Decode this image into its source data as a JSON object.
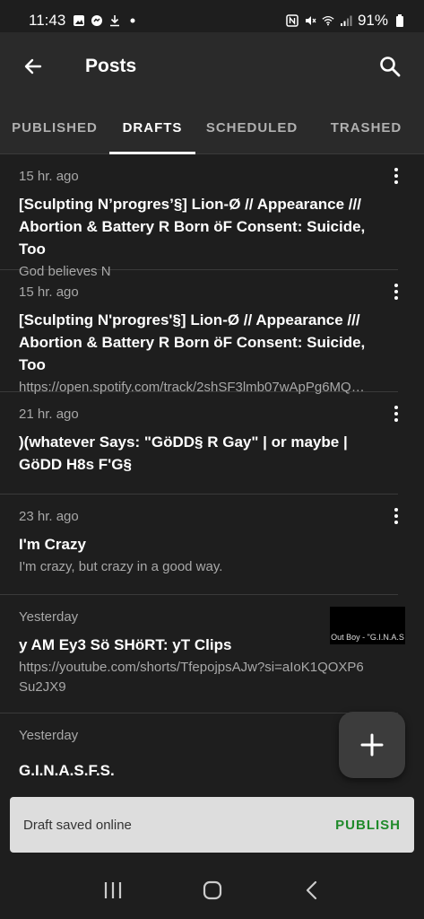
{
  "status_bar": {
    "time": "11:43",
    "battery": "91%"
  },
  "app_bar": {
    "title": "Posts"
  },
  "tabs": [
    {
      "label": "PUBLISHED",
      "active": false
    },
    {
      "label": "DRAFTS",
      "active": true
    },
    {
      "label": "SCHEDULED",
      "active": false
    },
    {
      "label": "TRASHED",
      "active": false
    }
  ],
  "posts": [
    {
      "time": "15 hr. ago",
      "title": "[Sculpting N’progres’§] Lion-Ø // Appearance /// Abortion & Battery R Born öF Consent: Suicide, Too",
      "excerpt": "God believes N"
    },
    {
      "time": "15 hr. ago",
      "title": "[Sculpting N'progres'§] Lion-Ø // Appearance /// Abortion & Battery R Born öF Consent: Suicide, Too",
      "excerpt": "https://open.spotify.com/track/2shSF3lmb07wApPg6MQYf..."
    },
    {
      "time": "21 hr. ago",
      "title": ")(whatever Says: \"GöDD§ R Gay\" | or maybe | GöDD H8s F'G§",
      "excerpt": ""
    },
    {
      "time": "23 hr. ago",
      "title": "I'm Crazy",
      "excerpt": "I'm crazy, but crazy in a good way."
    },
    {
      "time": "Yesterday",
      "title": "y AM Ey3 Sö SHöRT: yT Clips",
      "excerpt": "https://youtube.com/shorts/TfepojpsAJw?si=aIoK1QOXP6Su2JX9"
    },
    {
      "time": "Yesterday",
      "title": "G.I.N.A.S.F.S.",
      "excerpt": ""
    }
  ],
  "thumbnail_caption": "Out Boy - \"G.I.N.A.S",
  "snackbar": {
    "message": "Draft saved online",
    "action": "PUBLISH"
  },
  "colors": {
    "background": "#1e1e1e",
    "app_bar": "#2a2a2a",
    "snackbar_action": "#1f8a2a"
  }
}
